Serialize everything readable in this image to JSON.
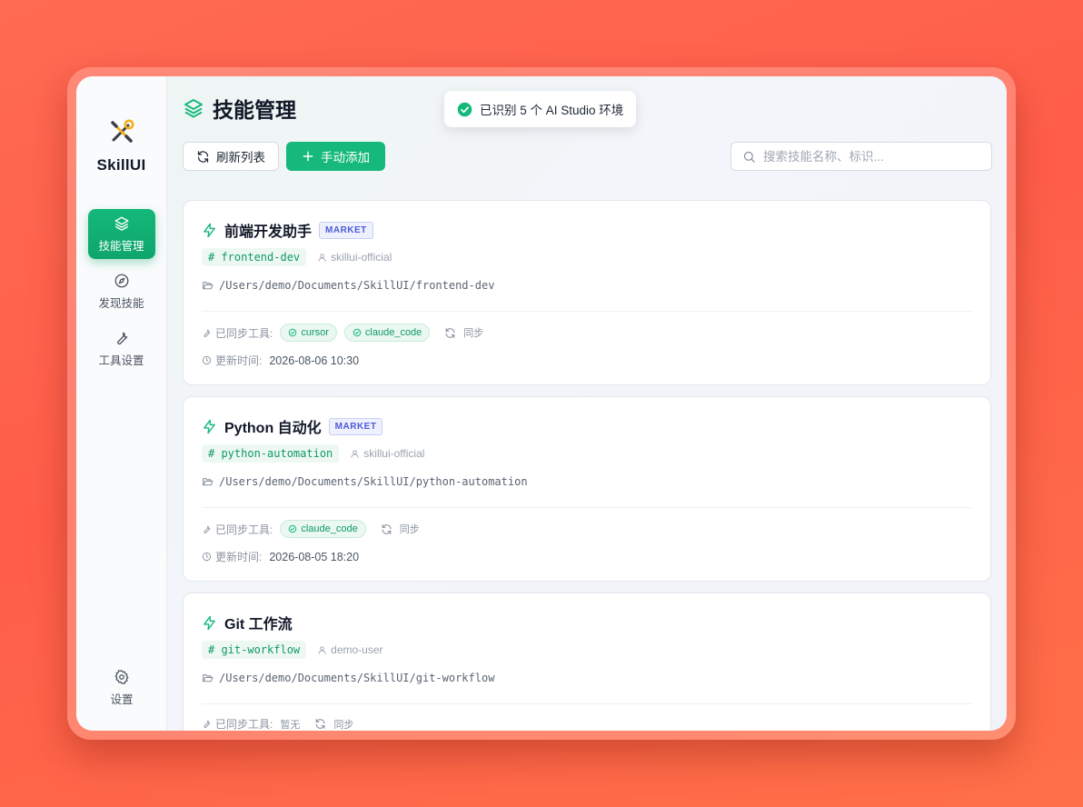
{
  "app": {
    "name": "SkillUI"
  },
  "sidebar": {
    "items": [
      {
        "label": "技能管理",
        "active": true,
        "icon": "layers-icon"
      },
      {
        "label": "发现技能",
        "active": false,
        "icon": "compass-icon"
      },
      {
        "label": "工具设置",
        "active": false,
        "icon": "wrench-icon"
      }
    ],
    "settings_label": "设置"
  },
  "header": {
    "title": "技能管理"
  },
  "toast": {
    "text": "已识别 5 个 AI Studio 环境"
  },
  "toolbar": {
    "refresh_label": "刷新列表",
    "add_label": "手动添加"
  },
  "search": {
    "placeholder": "搜索技能名称、标识..."
  },
  "labels": {
    "synced_tools": "已同步工具:",
    "sync": "同步",
    "updated": "更新时间:",
    "none": "暂无"
  },
  "skills": [
    {
      "title": "前端开发助手",
      "badge": "MARKET",
      "slug": "# frontend-dev",
      "author": "skillui-official",
      "path": "/Users/demo/Documents/SkillUI/frontend-dev",
      "tools": [
        "cursor",
        "claude_code"
      ],
      "updated": "2026-08-06 10:30"
    },
    {
      "title": "Python 自动化",
      "badge": "MARKET",
      "slug": "# python-automation",
      "author": "skillui-official",
      "path": "/Users/demo/Documents/SkillUI/python-automation",
      "tools": [
        "claude_code"
      ],
      "updated": "2026-08-05 18:20"
    },
    {
      "title": "Git 工作流",
      "badge": "",
      "slug": "# git-workflow",
      "author": "demo-user",
      "path": "/Users/demo/Documents/SkillUI/git-workflow",
      "tools": [],
      "updated": ""
    }
  ],
  "colors": {
    "accent": "#16b97b",
    "badge": "#4f5bd5",
    "background": "#ff5e4a"
  }
}
